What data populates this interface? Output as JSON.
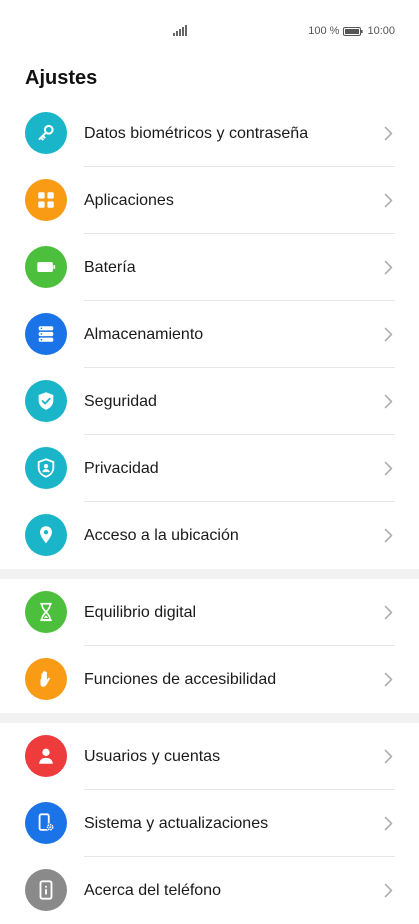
{
  "status": {
    "battery_pct": "100 %",
    "time": "10:00"
  },
  "title": "Ajustes",
  "groups": [
    {
      "items": [
        {
          "label": "Datos biométricos y contraseña",
          "icon": "key-icon",
          "color": "#1BB5C9"
        },
        {
          "label": "Aplicaciones",
          "icon": "apps-icon",
          "color": "#F99B14"
        },
        {
          "label": "Batería",
          "icon": "battery-icon",
          "color": "#4CC03C"
        },
        {
          "label": "Almacenamiento",
          "icon": "storage-icon",
          "color": "#1B73E8"
        },
        {
          "label": "Seguridad",
          "icon": "shield-check-icon",
          "color": "#1BB5C9"
        },
        {
          "label": "Privacidad",
          "icon": "privacy-shield-icon",
          "color": "#1BB5C9"
        },
        {
          "label": "Acceso a la ubicación",
          "icon": "location-pin-icon",
          "color": "#1BB5C9"
        }
      ]
    },
    {
      "items": [
        {
          "label": "Equilibrio digital",
          "icon": "hourglass-icon",
          "color": "#4CC03C"
        },
        {
          "label": "Funciones de accesibilidad",
          "icon": "hand-icon",
          "color": "#F99B14"
        }
      ]
    },
    {
      "items": [
        {
          "label": "Usuarios y cuentas",
          "icon": "user-icon",
          "color": "#EE3B3B"
        },
        {
          "label": "Sistema y actualizaciones",
          "icon": "phone-gear-icon",
          "color": "#1B73E8"
        },
        {
          "label": "Acerca del teléfono",
          "icon": "phone-info-icon",
          "color": "#8A8A8A"
        }
      ]
    }
  ]
}
